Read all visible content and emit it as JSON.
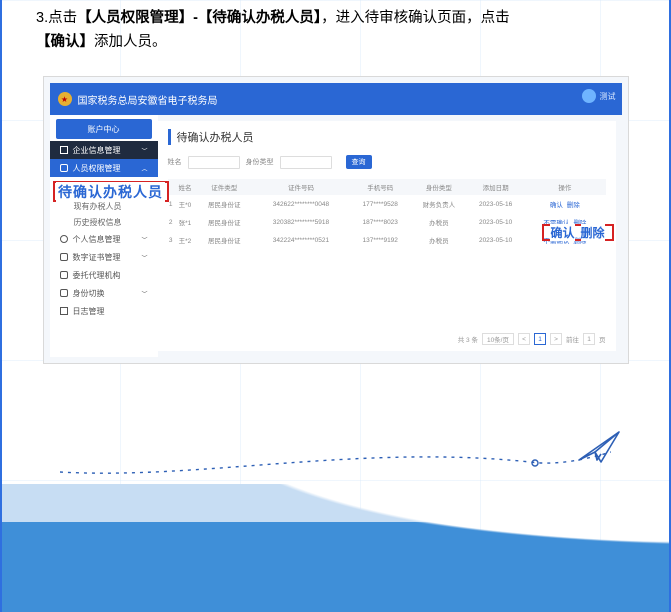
{
  "instruction": {
    "step_no": "3.",
    "t1": "点击",
    "b1": "【人员权限管理】-【待确认办税人员】",
    "t2": "，进入待审核确认页面，点击",
    "b2": "【确认】",
    "t3": "添加人员。"
  },
  "topbar": {
    "title": "国家税务总局安徽省电子税务局",
    "user": "测试"
  },
  "sidebar": {
    "tab": "账户中心",
    "items": [
      {
        "label": "企业信息管理",
        "kind": "dark"
      },
      {
        "label": "人员权限管理",
        "kind": "blue"
      }
    ],
    "highlight": "待确认办税人员",
    "sub1": "现有办税人员",
    "sub2": "历史授权信息",
    "rest": [
      "个人信息管理",
      "数字证书管理",
      "委托代理机构",
      "身份切换",
      "日志管理"
    ]
  },
  "main": {
    "title": "待确认办税人员",
    "filter_l1": "姓名",
    "filter_l2": "身份类型",
    "query": "查询",
    "headers": [
      "",
      "姓名",
      "证件类型",
      "证件号码",
      "手机号码",
      "身份类型",
      "添加日期",
      "操作"
    ],
    "rows": [
      {
        "c": [
          "1",
          "王*0",
          "居民身份证",
          "342622********0048",
          "177****9528",
          "财务负责人",
          "2023-05-16"
        ],
        "ops": [
          "确认",
          "删除"
        ]
      },
      {
        "c": [
          "2",
          "张*1",
          "居民身份证",
          "320382********5918",
          "187****8023",
          "办税员",
          "2023-05-10"
        ],
        "ops": [
          "不需确认",
          "删除"
        ]
      },
      {
        "c": [
          "3",
          "王*2",
          "居民身份证",
          "342224********0521",
          "137****9192",
          "办税员",
          "2023-05-10"
        ],
        "ops": [
          "不需确认",
          "删除"
        ]
      }
    ],
    "act_hi": [
      "确认",
      "删除"
    ],
    "pager": {
      "total": "共 3 条",
      "per": "10条/页",
      "prev": "<",
      "cur": "1",
      "next": ">",
      "goto": "前往",
      "pg": "1",
      "unit": "页"
    }
  }
}
